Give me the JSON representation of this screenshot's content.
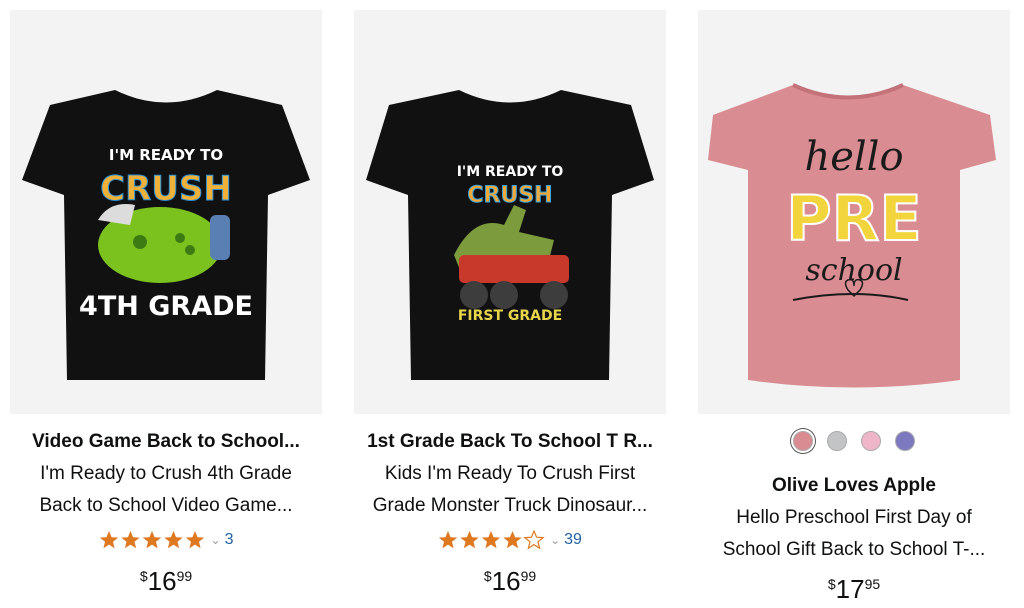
{
  "products": [
    {
      "brand": "Video Game Back to School...",
      "title_lines": [
        "I'm Ready to Crush 4th Grade",
        "Back to School Video Game..."
      ],
      "rating": 5,
      "rating_count": "3",
      "price": {
        "symbol": "$",
        "whole": "16",
        "fraction": "99"
      },
      "art": {
        "line1": "I'M READY TO",
        "line2": "CRUSH",
        "line3": "4TH GRADE"
      },
      "shirt_color": "#111111"
    },
    {
      "brand": "1st Grade Back To School T R...",
      "title_lines": [
        "Kids I'm Ready To Crush First",
        "Grade Monster Truck Dinosaur..."
      ],
      "rating": 4.5,
      "rating_count": "39",
      "price": {
        "symbol": "$",
        "whole": "16",
        "fraction": "99"
      },
      "art": {
        "line1": "I'M READY TO",
        "line2": "CRUSH",
        "line3": "FIRST GRADE"
      },
      "shirt_color": "#111111"
    },
    {
      "brand": "Olive Loves Apple",
      "title_lines": [
        "Hello Preschool First Day of",
        "School Gift Back to School T-..."
      ],
      "swatches": [
        {
          "color": "#d98c92",
          "selected": true
        },
        {
          "color": "#c2c4c6",
          "selected": false
        },
        {
          "color": "#efb5c8",
          "selected": false
        },
        {
          "color": "#7d79c0",
          "selected": false
        }
      ],
      "price": {
        "symbol": "$",
        "whole": "17",
        "fraction": "95"
      },
      "art": {
        "line1": "hello",
        "line2": "PRE",
        "line3": "school"
      },
      "shirt_color": "#d98c92"
    }
  ],
  "colors": {
    "star": "#de7921",
    "link": "#2162a1",
    "image_bg": "#f3f3f3"
  },
  "icons": {
    "star": "star-icon",
    "caret": "chevron-down-icon"
  }
}
